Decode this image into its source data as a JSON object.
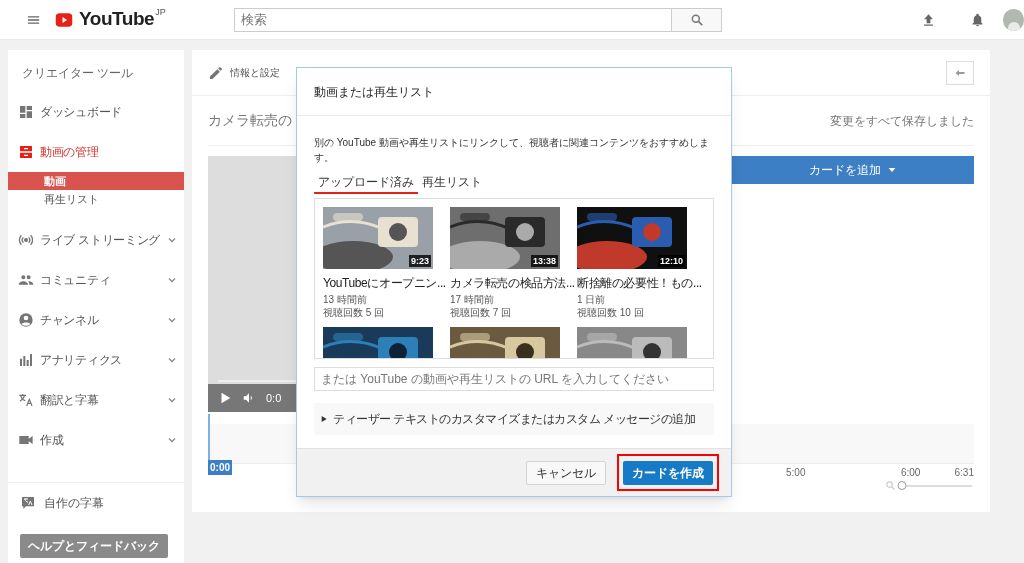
{
  "header": {
    "logo": "YouTube",
    "region": "JP",
    "search": {
      "placeholder": "検索"
    }
  },
  "sidebar": {
    "title": "クリエイター ツール",
    "items": [
      {
        "label": "ダッシュボード",
        "expandable": false,
        "selected": false
      },
      {
        "label": "動画の管理",
        "expandable": false,
        "selected": true,
        "children": [
          {
            "label": "動画",
            "selected": true
          },
          {
            "label": "再生リスト",
            "selected": false
          }
        ]
      },
      {
        "label": "ライブ ストリーミング",
        "expandable": true,
        "selected": false
      },
      {
        "label": "コミュニティ",
        "expandable": true,
        "selected": false
      },
      {
        "label": "チャンネル",
        "expandable": true,
        "selected": false
      },
      {
        "label": "アナリティクス",
        "expandable": true,
        "selected": false
      },
      {
        "label": "翻訳と字幕",
        "expandable": true,
        "selected": false
      },
      {
        "label": "作成",
        "expandable": true,
        "selected": false
      }
    ],
    "extra": {
      "label": "自作の字幕"
    },
    "help_button": "ヘルプとフィードバック"
  },
  "editor": {
    "tab": "情報と設定",
    "title": "カメラ転売の",
    "status": "変更をすべて保存しました",
    "player_time": "0:0",
    "add_card_button": "カードを追加",
    "timeline": {
      "playhead": "0:00",
      "ticks": [
        "5:00",
        "6:00",
        "6:31"
      ]
    },
    "zoom_slider": {
      "level": 0
    }
  },
  "dialog": {
    "title": "動画または再生リスト",
    "description": "別の YouTube 動画や再生リストにリンクして、視聴者に関連コンテンツをおすすめします。",
    "tabs": [
      {
        "label": "アップロード済み",
        "selected": true
      },
      {
        "label": "再生リスト",
        "selected": false
      }
    ],
    "videos": [
      {
        "title": "YouTubeにオープニン...",
        "age": "13 時間前",
        "views": "視聴回数 5 回",
        "duration": "9:23"
      },
      {
        "title": "カメラ転売の検品方法...",
        "age": "17 時間前",
        "views": "視聴回数 7 回",
        "duration": "13:38"
      },
      {
        "title": "断捨離の必要性！もの...",
        "age": "1 日前",
        "views": "視聴回数 10 回",
        "duration": "12:10"
      }
    ],
    "url_field": {
      "placeholder": "または YouTube の動画や再生リストの URL を入力してください"
    },
    "teaser": {
      "label": "ティーザー テキストのカスタマイズまたはカスタム メッセージの追加",
      "expanded": false
    },
    "buttons": [
      {
        "label": "キャンセル",
        "kind": "secondary",
        "highlighted": false
      },
      {
        "label": "カードを作成",
        "kind": "primary",
        "highlighted": true
      }
    ]
  }
}
